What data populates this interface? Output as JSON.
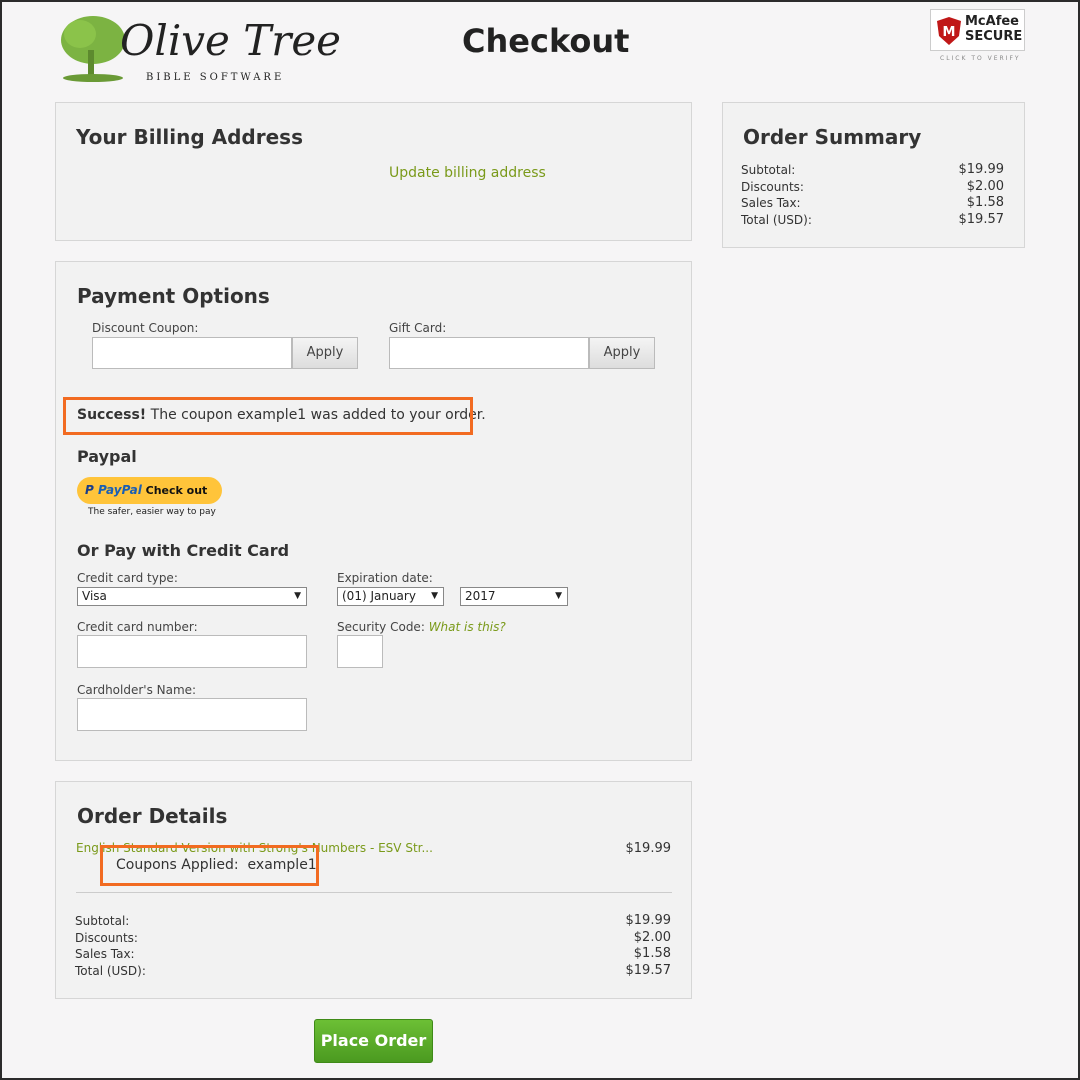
{
  "header": {
    "logo_text": "Olive Tree",
    "logo_sub": "BIBLE SOFTWARE",
    "title": "Checkout",
    "badge": {
      "brand": "McAfee",
      "secure": "SECURE",
      "verify": "CLICK TO VERIFY"
    }
  },
  "billing": {
    "title": "Your Billing Address",
    "update_link": "Update billing address"
  },
  "payment": {
    "title": "Payment Options",
    "coupon_label": "Discount Coupon:",
    "coupon_value": "",
    "giftcard_label": "Gift Card:",
    "giftcard_value": "",
    "apply": "Apply",
    "success_bold": "Success!",
    "success_text": " The coupon example1 was added to your order.",
    "paypal_title": "Paypal",
    "paypal_brand": "PayPal",
    "paypal_checkout": "Check out",
    "paypal_tagline": "The safer, easier way to pay",
    "cc_title": "Or Pay with Credit Card",
    "cc_type_label": "Credit card type:",
    "cc_type_value": "Visa",
    "exp_label": "Expiration date:",
    "exp_month": "(01) January",
    "exp_year": "2017",
    "cc_number_label": "Credit card number:",
    "security_label": "Security Code:",
    "security_help": "What is this?",
    "name_label": "Cardholder's Name:"
  },
  "order_details": {
    "title": "Order Details",
    "item_name": "English Standard Version with Strong's Numbers - ESV Str...",
    "item_price": "$19.99",
    "coupons_label": "Coupons Applied:",
    "coupons_value": "example1",
    "rows": [
      {
        "label": "Subtotal:",
        "value": "$19.99"
      },
      {
        "label": "Discounts:",
        "value": "$2.00"
      },
      {
        "label": "Sales Tax:",
        "value": "$1.58"
      },
      {
        "label": "Total (USD):",
        "value": "$19.57"
      }
    ]
  },
  "summary": {
    "title": "Order Summary",
    "rows": [
      {
        "label": "Subtotal:",
        "value": "$19.99"
      },
      {
        "label": "Discounts:",
        "value": "$2.00"
      },
      {
        "label": "Sales Tax:",
        "value": "$1.58"
      },
      {
        "label": "Total (USD):",
        "value": "$19.57"
      }
    ]
  },
  "place_order": "Place Order",
  "colors": {
    "accent_green": "#7a9a1a",
    "highlight": "#f26b21",
    "place_order": "#5aa829"
  }
}
